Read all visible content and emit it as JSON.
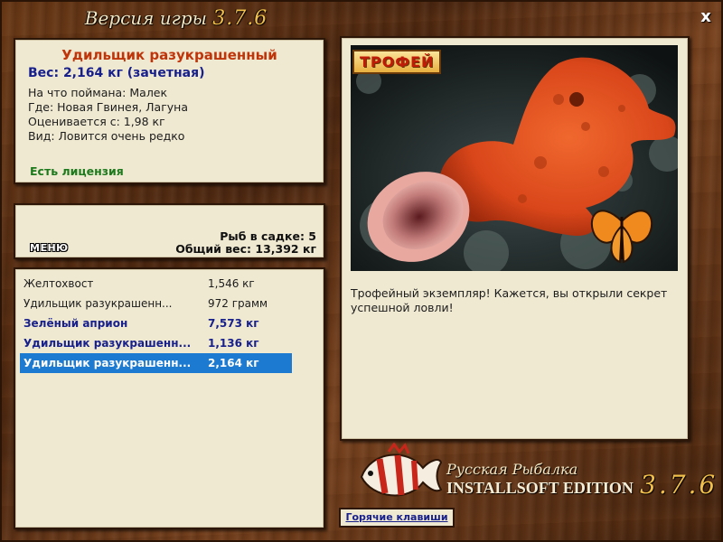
{
  "window": {
    "title_prefix": "Версия игры",
    "title_version": "3.7.6",
    "close_label": "x"
  },
  "fish_info": {
    "name": "Удильщик разукрашенный",
    "weight": "Вес: 2,164 кг (зачетная)",
    "bait": "На что поймана: Малек",
    "location": "Где: Новая Гвинея, Лагуна",
    "valued_from": "Оценивается с: 1,98 кг",
    "rarity": "Вид: Ловится очень редко",
    "license": "Есть лицензия"
  },
  "cage": {
    "menu_label": "МЕНЮ",
    "fish_count": "Рыб в садке: 5",
    "total_weight": "Общий вес: 13,392 кг"
  },
  "catch_list": [
    {
      "name": "Желтохвост",
      "weight": "1,546 кг",
      "trophy": false,
      "selected": false
    },
    {
      "name": "Удильщик разукрашенн...",
      "weight": "972 грамм",
      "trophy": false,
      "selected": false
    },
    {
      "name": "Зелёный априон",
      "weight": "7,573 кг",
      "trophy": true,
      "selected": false
    },
    {
      "name": "Удильщик разукрашенн...",
      "weight": "1,136 кг",
      "trophy": true,
      "selected": false
    },
    {
      "name": "Удильщик разукрашенн...",
      "weight": "2,164 кг",
      "trophy": true,
      "selected": true
    }
  ],
  "photo": {
    "badge": "ТРОФЕЙ",
    "caption": "Трофейный экземпляр! Кажется, вы открыли секрет успешной ловли!"
  },
  "brand": {
    "line1": "Русская Рыбалка",
    "line2": "INSTALLSOFT EDITION",
    "version": "3.7.6"
  },
  "footer": {
    "hotkeys_label": "Горячие клавиши"
  },
  "colors": {
    "panel_bg": "#efe9d2",
    "fish_name": "#c0340a",
    "trophy_blue": "#18208c",
    "license_green": "#1c7a1c",
    "selection": "#1c7ad0"
  }
}
